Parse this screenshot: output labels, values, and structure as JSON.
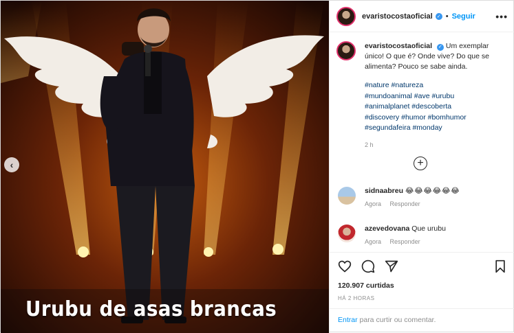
{
  "post": {
    "username": "evaristocostaoficial",
    "follow_label": "Seguir",
    "separator": "•",
    "more_label": "•••",
    "image_caption": "Urubu de asas brancas",
    "caption_text": "Um exemplar único! O que é? Onde vive? Do que se alimenta? Pouco se sabe ainda.",
    "hashtags": [
      "#nature #natureza",
      "#mundoanimal #ave #urubu",
      "#animalplanet #descoberta",
      "#discovery #humor #bomhumor",
      "#segundafeira #monday"
    ],
    "caption_time": "2 h",
    "likes": "120.907 curtidas",
    "posted_ago": "HÁ 2 HORAS"
  },
  "comments": [
    {
      "user": "sidnaabreu",
      "text": "😂😂😂😂😂😂",
      "time": "Agora",
      "reply": "Responder"
    },
    {
      "user": "azevedovana",
      "text": "Que urubu",
      "time": "Agora",
      "reply": "Responder"
    }
  ],
  "login_bar": {
    "link": "Entrar",
    "rest": " para curtir ou comentar."
  },
  "icons": [
    "chevron-left-icon",
    "verified-icon",
    "more-icon",
    "add-comments-icon",
    "heart-icon",
    "comment-icon",
    "share-icon",
    "bookmark-icon"
  ],
  "colors": {
    "accent": "#0095f6",
    "verified": "#3897f0",
    "stage": "#e07a10"
  }
}
